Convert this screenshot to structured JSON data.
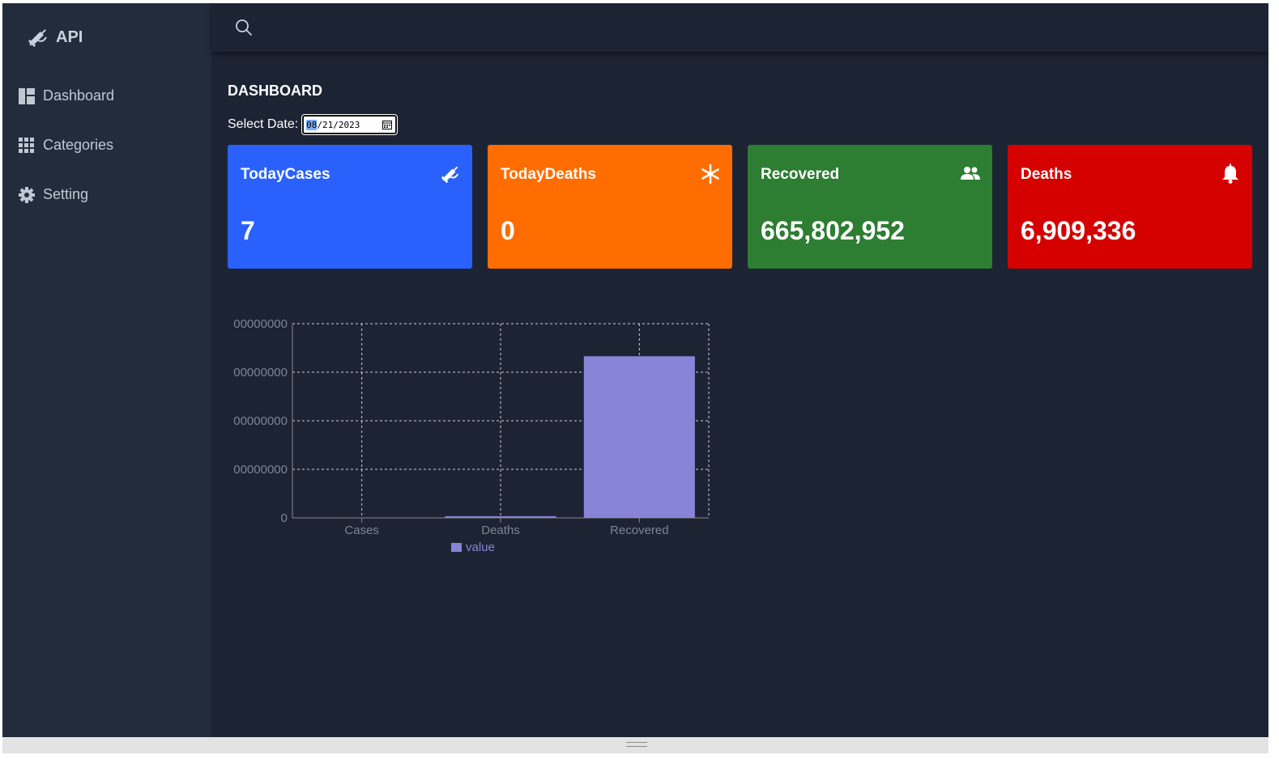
{
  "brand": {
    "title": "API",
    "icon": "syringe-icon"
  },
  "sidebar": {
    "items": [
      {
        "label": "Dashboard",
        "icon": "dashboard-icon"
      },
      {
        "label": "Categories",
        "icon": "grid-icon"
      },
      {
        "label": "Setting",
        "icon": "gear-icon"
      }
    ]
  },
  "topbar": {
    "search_icon": "search-icon"
  },
  "main": {
    "title": "DASHBOARD",
    "date_label": "Select Date:",
    "date_month": "08",
    "date_rest": "/21/2023"
  },
  "cards": [
    {
      "title": "TodayCases",
      "value": "7",
      "color": "#2a61fd",
      "icon": "syringe-icon"
    },
    {
      "title": "TodayDeaths",
      "value": "0",
      "color": "#ff6d00",
      "icon": "asterisk-icon"
    },
    {
      "title": "Recovered",
      "value": "665,802,952",
      "color": "#2d7d32",
      "icon": "users-icon"
    },
    {
      "title": "Deaths",
      "value": "6,909,336",
      "color": "#d50000",
      "icon": "bell-icon"
    }
  ],
  "chart_data": {
    "type": "bar",
    "categories": [
      "Cases",
      "Deaths",
      "Recovered"
    ],
    "series": [
      {
        "name": "value",
        "values": [
          0,
          6909336,
          665802952
        ],
        "color": "#8884d8"
      }
    ],
    "y_tick_labels": [
      "0",
      "00000000",
      "00000000",
      "00000000",
      "00000000"
    ],
    "ylim": [
      0,
      800000000
    ],
    "grid": true,
    "legend": "bottom"
  }
}
